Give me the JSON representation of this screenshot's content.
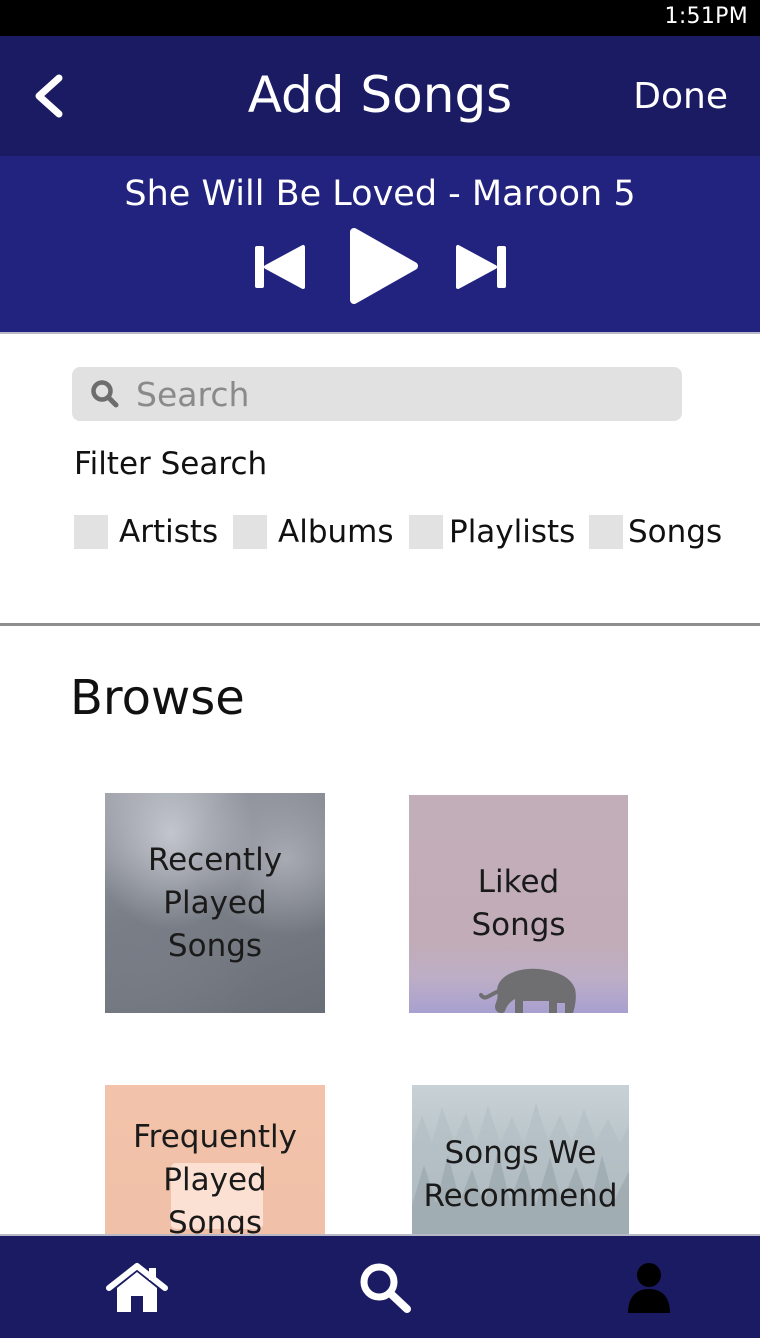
{
  "status_bar": {
    "time": "1:51PM"
  },
  "header": {
    "title": "Add Songs",
    "done_label": "Done",
    "back_icon": "chevron-left-icon"
  },
  "player": {
    "now_playing": "She Will Be Loved - Maroon 5",
    "controls": [
      "skip-previous-icon",
      "play-icon",
      "skip-next-icon"
    ]
  },
  "search": {
    "placeholder": "Search",
    "value": "",
    "filter_title": "Filter Search",
    "filters": [
      {
        "label": "Artists",
        "checked": false
      },
      {
        "label": "Albums",
        "checked": false
      },
      {
        "label": "Playlists",
        "checked": false
      },
      {
        "label": "Songs",
        "checked": false
      }
    ]
  },
  "browse": {
    "title": "Browse",
    "tiles": [
      {
        "line1": "Recently",
        "line2": "Played",
        "line3": "Songs"
      },
      {
        "line1": "Liked",
        "line2": "Songs"
      },
      {
        "line1": "Frequently",
        "line2": "Played",
        "line3": "Songs"
      },
      {
        "line1": "Songs We",
        "line2": "Recommend"
      }
    ]
  },
  "bottom_nav": {
    "items": [
      {
        "icon": "home-icon"
      },
      {
        "icon": "search-icon"
      },
      {
        "icon": "profile-icon"
      }
    ]
  },
  "colors": {
    "header_bg": "#1b1b64",
    "player_bg": "#22237f",
    "search_bg": "#e1e1e1",
    "checkbox_bg": "#e2e2e2"
  }
}
